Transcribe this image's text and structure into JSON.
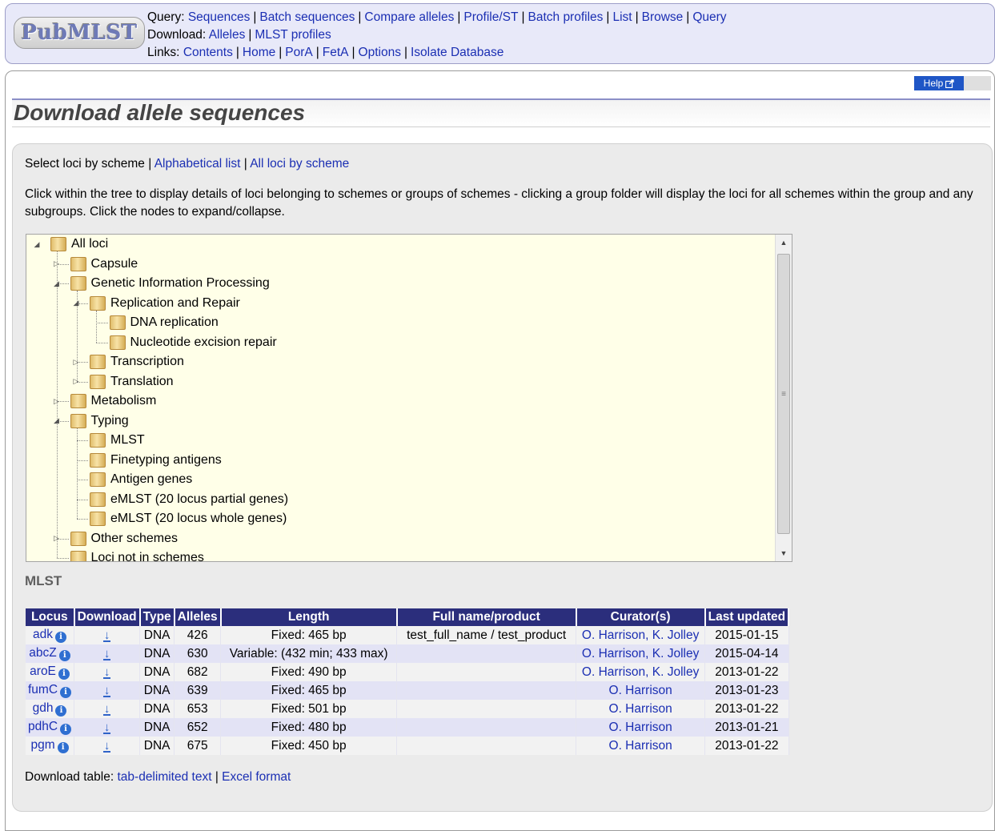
{
  "header": {
    "logo_text": "PubMLST",
    "query_label": "Query:",
    "query_links": [
      "Sequences",
      "Batch sequences",
      "Compare alleles",
      "Profile/ST",
      "Batch profiles",
      "List",
      "Browse",
      "Query"
    ],
    "download_label": "Download:",
    "download_links": [
      "Alleles",
      "MLST profiles"
    ],
    "links_label": "Links:",
    "links_links": [
      "Contents",
      "Home",
      "PorA",
      "FetA",
      "Options",
      "Isolate Database"
    ]
  },
  "help_button": "Help",
  "page_title": "Download allele sequences",
  "scheme_selector": {
    "current": "Select loci by scheme",
    "links": [
      "Alphabetical list",
      "All loci by scheme"
    ]
  },
  "instructions": "Click within the tree to display details of loci belonging to schemes or groups of schemes - clicking a group folder will display the loci for all schemes within the group and any subgroups. Click the nodes to expand/collapse.",
  "tree": [
    {
      "label": "All loci",
      "level": 0,
      "state": "open"
    },
    {
      "label": "Capsule",
      "level": 1,
      "state": "closed"
    },
    {
      "label": "Genetic Information Processing",
      "level": 1,
      "state": "open"
    },
    {
      "label": "Replication and Repair",
      "level": 2,
      "state": "open"
    },
    {
      "label": "DNA replication",
      "level": 3,
      "state": "leaf"
    },
    {
      "label": "Nucleotide excision repair",
      "level": 3,
      "state": "leaf"
    },
    {
      "label": "Transcription",
      "level": 2,
      "state": "closed"
    },
    {
      "label": "Translation",
      "level": 2,
      "state": "closed"
    },
    {
      "label": "Metabolism",
      "level": 1,
      "state": "closed"
    },
    {
      "label": "Typing",
      "level": 1,
      "state": "open"
    },
    {
      "label": "MLST",
      "level": 2,
      "state": "leaf"
    },
    {
      "label": "Finetyping antigens",
      "level": 2,
      "state": "leaf"
    },
    {
      "label": "Antigen genes",
      "level": 2,
      "state": "leaf"
    },
    {
      "label": "eMLST (20 locus partial genes)",
      "level": 2,
      "state": "leaf"
    },
    {
      "label": "eMLST (20 locus whole genes)",
      "level": 2,
      "state": "leaf"
    },
    {
      "label": "Other schemes",
      "level": 1,
      "state": "closed"
    },
    {
      "label": "Loci not in schemes",
      "level": 1,
      "state": "leaf"
    }
  ],
  "scheme": {
    "heading": "MLST",
    "columns": [
      "Locus",
      "Download",
      "Type",
      "Alleles",
      "Length",
      "Full name/product",
      "Curator(s)",
      "Last updated"
    ],
    "rows": [
      {
        "locus": "adk",
        "type": "DNA",
        "alleles": "426",
        "length": "Fixed: 465 bp",
        "product": "test_full_name / test_product",
        "curators": "O. Harrison, K. Jolley",
        "updated": "2015-01-15"
      },
      {
        "locus": "abcZ",
        "type": "DNA",
        "alleles": "630",
        "length": "Variable: (432 min; 433 max)",
        "product": "",
        "curators": "O. Harrison, K. Jolley",
        "updated": "2015-04-14"
      },
      {
        "locus": "aroE",
        "type": "DNA",
        "alleles": "682",
        "length": "Fixed: 490 bp",
        "product": "",
        "curators": "O. Harrison, K. Jolley",
        "updated": "2013-01-22"
      },
      {
        "locus": "fumC",
        "type": "DNA",
        "alleles": "639",
        "length": "Fixed: 465 bp",
        "product": "",
        "curators": "O. Harrison",
        "updated": "2013-01-23"
      },
      {
        "locus": "gdh",
        "type": "DNA",
        "alleles": "653",
        "length": "Fixed: 501 bp",
        "product": "",
        "curators": "O. Harrison",
        "updated": "2013-01-22"
      },
      {
        "locus": "pdhC",
        "type": "DNA",
        "alleles": "652",
        "length": "Fixed: 480 bp",
        "product": "",
        "curators": "O. Harrison",
        "updated": "2013-01-21"
      },
      {
        "locus": "pgm",
        "type": "DNA",
        "alleles": "675",
        "length": "Fixed: 450 bp",
        "product": "",
        "curators": "O. Harrison",
        "updated": "2013-01-22"
      }
    ]
  },
  "download_table": {
    "label": "Download table:",
    "links": [
      "tab-delimited text",
      "Excel format"
    ]
  },
  "icons": {
    "info": "info-icon",
    "download": "download-icon",
    "external": "external-link-icon",
    "folder": "folder-icon"
  },
  "colors": {
    "header_bg": "#e8e9f9",
    "link": "#1b2fb3",
    "table_header": "#2b2e7c",
    "tree_bg": "#ffffe8"
  }
}
